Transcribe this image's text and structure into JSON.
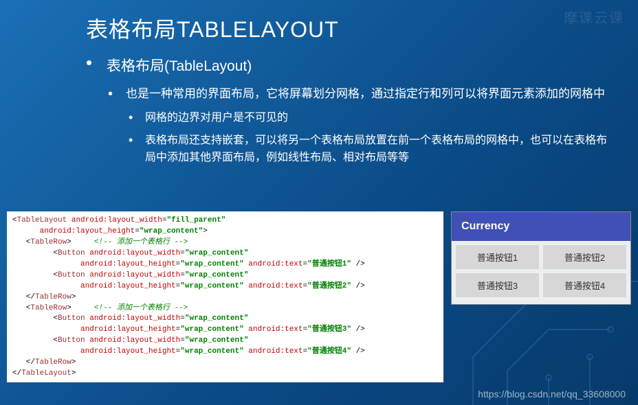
{
  "title": "表格布局TABLELAYOUT",
  "bullets": {
    "l1": "表格布局(TableLayout)",
    "l2": "也是一种常用的界面布局，它将屏幕划分网格，通过指定行和列可以将界面元素添加的网格中",
    "l3a": "网格的边界对用户是不可见的",
    "l3b": "表格布局还支持嵌套，可以将另一个表格布局放置在前一个表格布局的网格中，也可以在表格布局中添加其他界面布局，例如线性布局、相对布局等等"
  },
  "code": {
    "comment": "<!-- 添加一个表格行 -->",
    "btn1_text": "\"普通按钮1\"",
    "btn2_text": "\"普通按钮2\"",
    "btn3_text": "\"普通按钮3\"",
    "btn4_text": "\"普通按钮4\"",
    "fill_parent": "\"fill_parent\"",
    "wrap_content": "\"wrap_content\"",
    "tag_tablelayout_open": "TableLayout",
    "tag_tablerow": "TableRow",
    "tag_button": "Button",
    "attr_width": "android:layout_width",
    "attr_height": "android:layout_height",
    "attr_text": "android:text"
  },
  "preview": {
    "appbar_title": "Currency",
    "buttons": [
      "普通按钮1",
      "普通按钮2",
      "普通按钮3",
      "普通按钮4"
    ]
  },
  "watermark_top": "摩课云课",
  "watermark_url": "https://blog.csdn.net/qq_33608000"
}
